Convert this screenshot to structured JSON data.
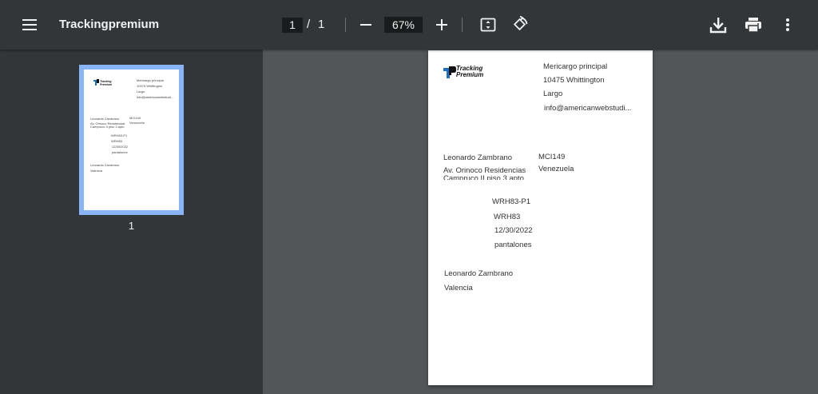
{
  "toolbar": {
    "title": "Trackingpremium",
    "page_current": "1",
    "page_separator": "/",
    "page_total": "1",
    "zoom": "67%",
    "icons": {
      "menu": "hamburger-menu-icon",
      "zoom_out": "minus-icon",
      "zoom_in": "plus-icon",
      "fit": "fit-to-page-icon",
      "rotate": "rotate-icon",
      "download": "download-icon",
      "print": "print-icon",
      "more": "more-vert-icon"
    }
  },
  "sidebar": {
    "thumbnail_label": "1"
  },
  "document": {
    "logo_line1": "Tracking",
    "logo_line2": "Premium",
    "sender": {
      "name": "Mericargo principal",
      "address": "10475 Whittington",
      "city": "Largo",
      "email": "info@americanwebstudi..."
    },
    "recipient": {
      "name": "Leonardo Zambrano",
      "address_line1": "Av. Orinoco Residencias",
      "address_line2": "Campruco II piso 3 apto",
      "code": "MCI149",
      "country": "Venezuela"
    },
    "details": {
      "reference": "WRH83-P1",
      "warehouse": "WRH83",
      "date": "12/30/2022",
      "content": "pantalones"
    },
    "footer": {
      "name": "Leonardo Zambrano",
      "city": "Valencia"
    }
  },
  "colors": {
    "toolbar_bg": "#323639",
    "sidebar_bg": "#323639",
    "viewer_bg": "#525659",
    "thumbnail_selected": "#8ab4f8",
    "logo_blue": "#1a6fc4"
  }
}
